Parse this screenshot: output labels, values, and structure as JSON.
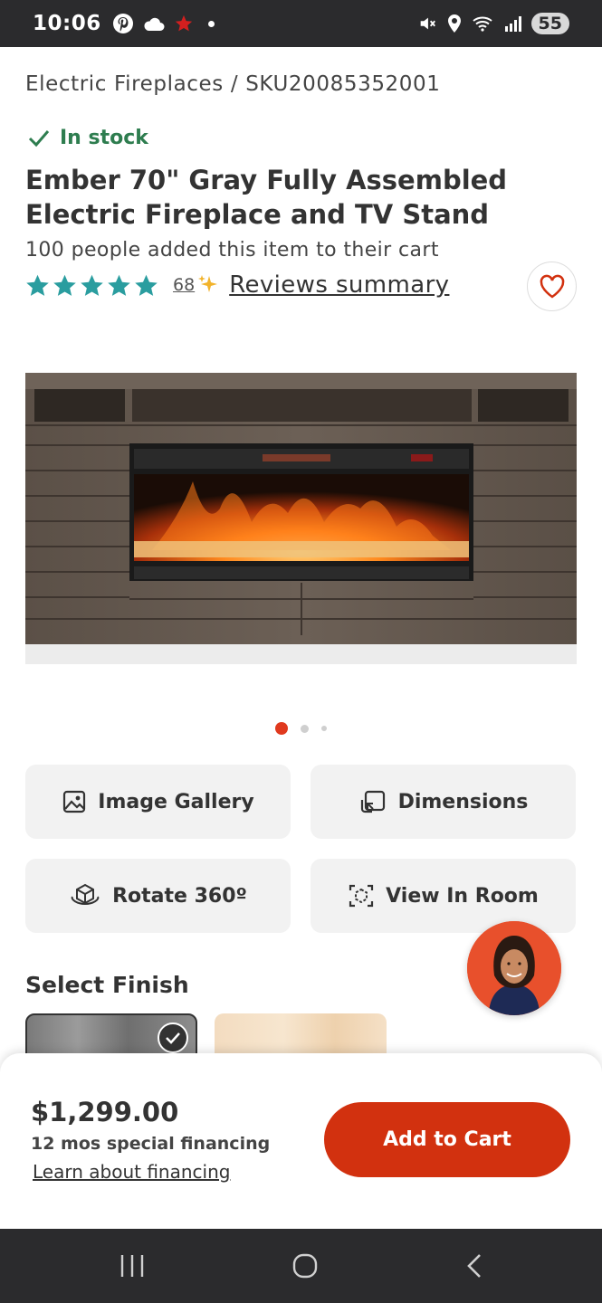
{
  "status_bar": {
    "time": "10:06",
    "battery": "55"
  },
  "breadcrumb": {
    "category": "Electric Fireplaces",
    "separator": "/",
    "sku": "SKU20085352001"
  },
  "product": {
    "stock_status": "In stock",
    "title": "Ember 70\" Gray Fully Assembled Electric Fireplace and TV Stand",
    "cart_count_text": "100 people added this item to their cart",
    "rating": 5,
    "review_count": "68",
    "reviews_summary_label": "Reviews summary"
  },
  "carousel": {
    "total": 3,
    "active_index": 0
  },
  "actions": {
    "image_gallery": "Image Gallery",
    "dimensions": "Dimensions",
    "rotate": "Rotate 360º",
    "view_in_room": "View In Room"
  },
  "finish": {
    "label": "Select Finish"
  },
  "purchase": {
    "price": "$1,299.00",
    "financing": "12 mos special financing",
    "learn_link": "Learn about financing",
    "add_to_cart": "Add to Cart"
  },
  "colors": {
    "accent": "#d2310f",
    "star": "#2a9d9f",
    "stock": "#2e7d4f",
    "dot_active": "#e0391e"
  },
  "icons": [
    "pinterest-icon",
    "cloud-icon",
    "star-icon",
    "mute-icon",
    "location-icon",
    "wifi-icon",
    "signal-icon",
    "check-icon",
    "heart-icon",
    "image-icon",
    "dimensions-icon",
    "rotate-360-icon",
    "view-in-room-icon",
    "recent-apps-icon",
    "home-icon",
    "back-icon"
  ]
}
